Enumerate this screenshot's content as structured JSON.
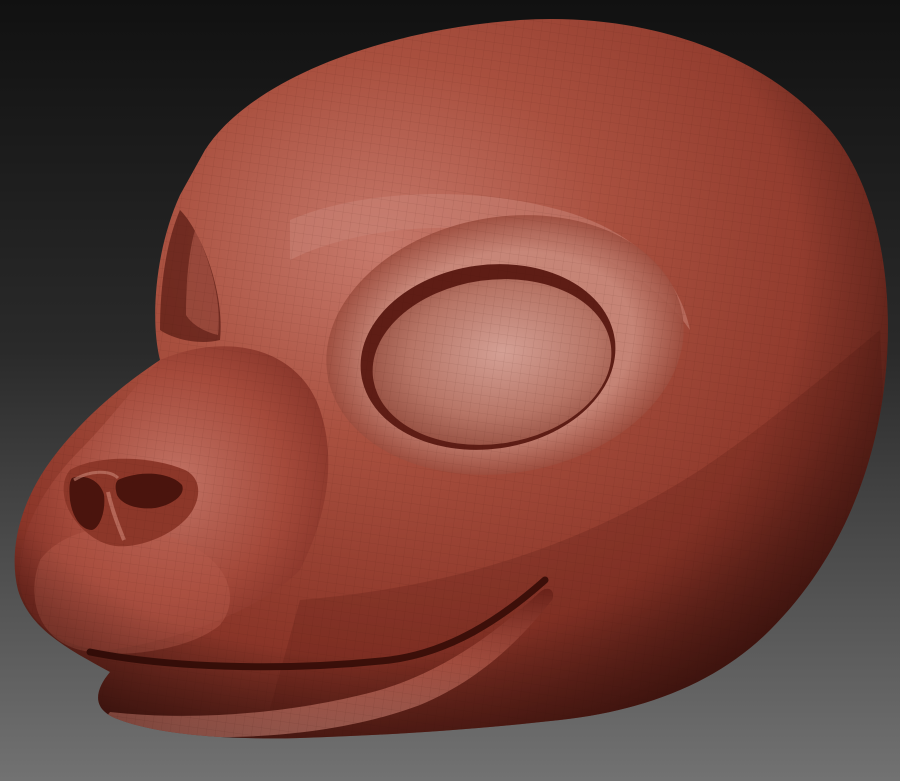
{
  "viewport": {
    "background_top": "#111111",
    "background_bottom": "#6e6e6e"
  },
  "model": {
    "subject": "sculpted-animal-head",
    "material_base": "#a0463a",
    "material_shadow": "#3e1511",
    "material_highlight": "#d89a8c",
    "wireframe_visible": true
  }
}
